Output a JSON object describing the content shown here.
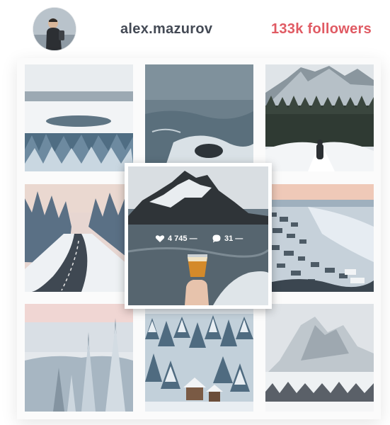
{
  "profile": {
    "username": "alex.mazurov",
    "followers": "133k followers",
    "avatar_icon": "avatar-photo",
    "accent_color": "#e05a63"
  },
  "feed": {
    "tiles": [
      {
        "name": "tile-frozen-lake-island"
      },
      {
        "name": "tile-ocean-waves-rocks"
      },
      {
        "name": "tile-snowy-mountain-hiker"
      },
      {
        "name": "tile-winter-road-trees"
      },
      {
        "name": "tile-snowy-town-aerial"
      },
      {
        "name": "tile-frosted-forest-pines"
      },
      {
        "name": "tile-snowy-village-forest"
      },
      {
        "name": "tile-misty-mountain-village"
      }
    ],
    "popup": {
      "likes": "4 745 —",
      "comments": "31 —",
      "like_icon": "heart-icon",
      "comment_icon": "comment-icon"
    }
  }
}
